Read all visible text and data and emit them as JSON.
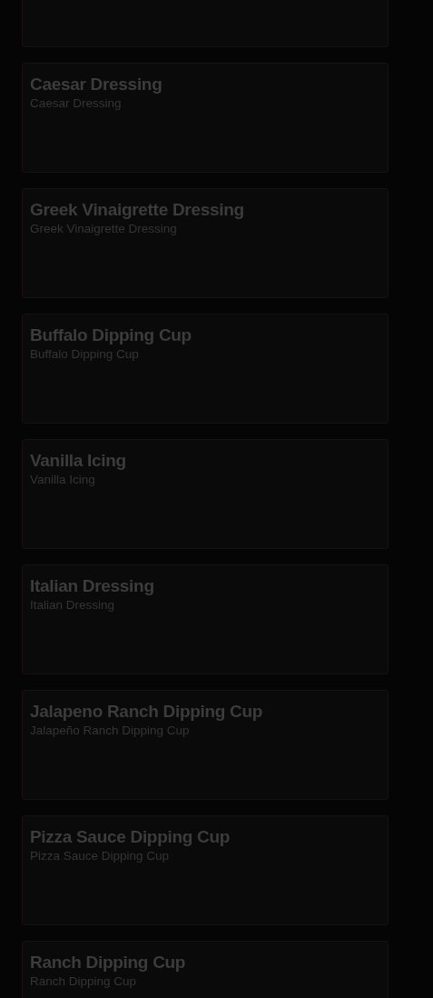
{
  "items": [
    {
      "title": "Caesar Dressing",
      "subtitle": "Caesar Dressing"
    },
    {
      "title": "Greek Vinaigrette Dressing",
      "subtitle": "Greek Vinaigrette Dressing"
    },
    {
      "title": "Buffalo Dipping Cup",
      "subtitle": "Buffalo Dipping Cup"
    },
    {
      "title": "Vanilla Icing",
      "subtitle": "Vanilla Icing"
    },
    {
      "title": "Italian Dressing",
      "subtitle": "Italian Dressing"
    },
    {
      "title": "Jalapeno Ranch Dipping Cup",
      "subtitle": "Jalapeño Ranch Dipping Cup"
    },
    {
      "title": "Pizza Sauce Dipping Cup",
      "subtitle": "Pizza Sauce Dipping Cup"
    },
    {
      "title": "Ranch Dipping Cup",
      "subtitle": "Ranch Dipping Cup"
    }
  ]
}
